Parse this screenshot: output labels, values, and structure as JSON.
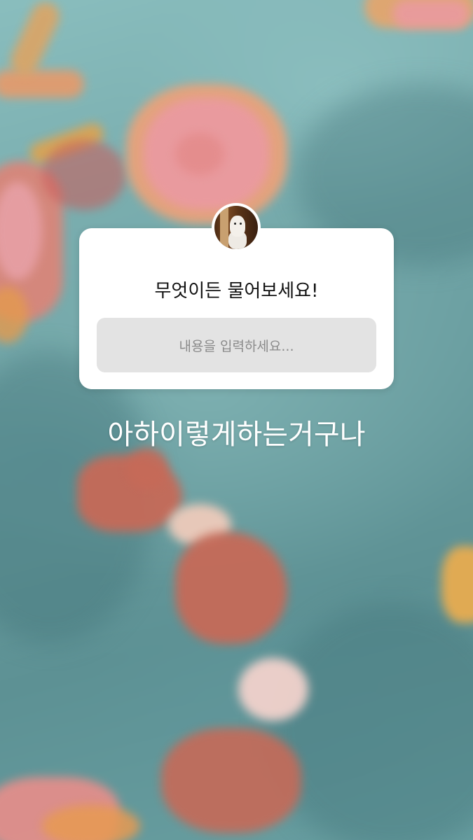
{
  "question_sticker": {
    "title": "무엇이든 물어보세요!",
    "placeholder": "내용을 입력하세요..."
  },
  "caption": {
    "text": "아하이렇게하는거구나"
  },
  "colors": {
    "background": "#74a9aa",
    "card": "#ffffff",
    "input_fill": "#e3e3e3",
    "placeholder_text": "#8a8a8a",
    "caption_text": "#ffffff"
  },
  "icons": {
    "avatar": "profile-photo-dog"
  }
}
